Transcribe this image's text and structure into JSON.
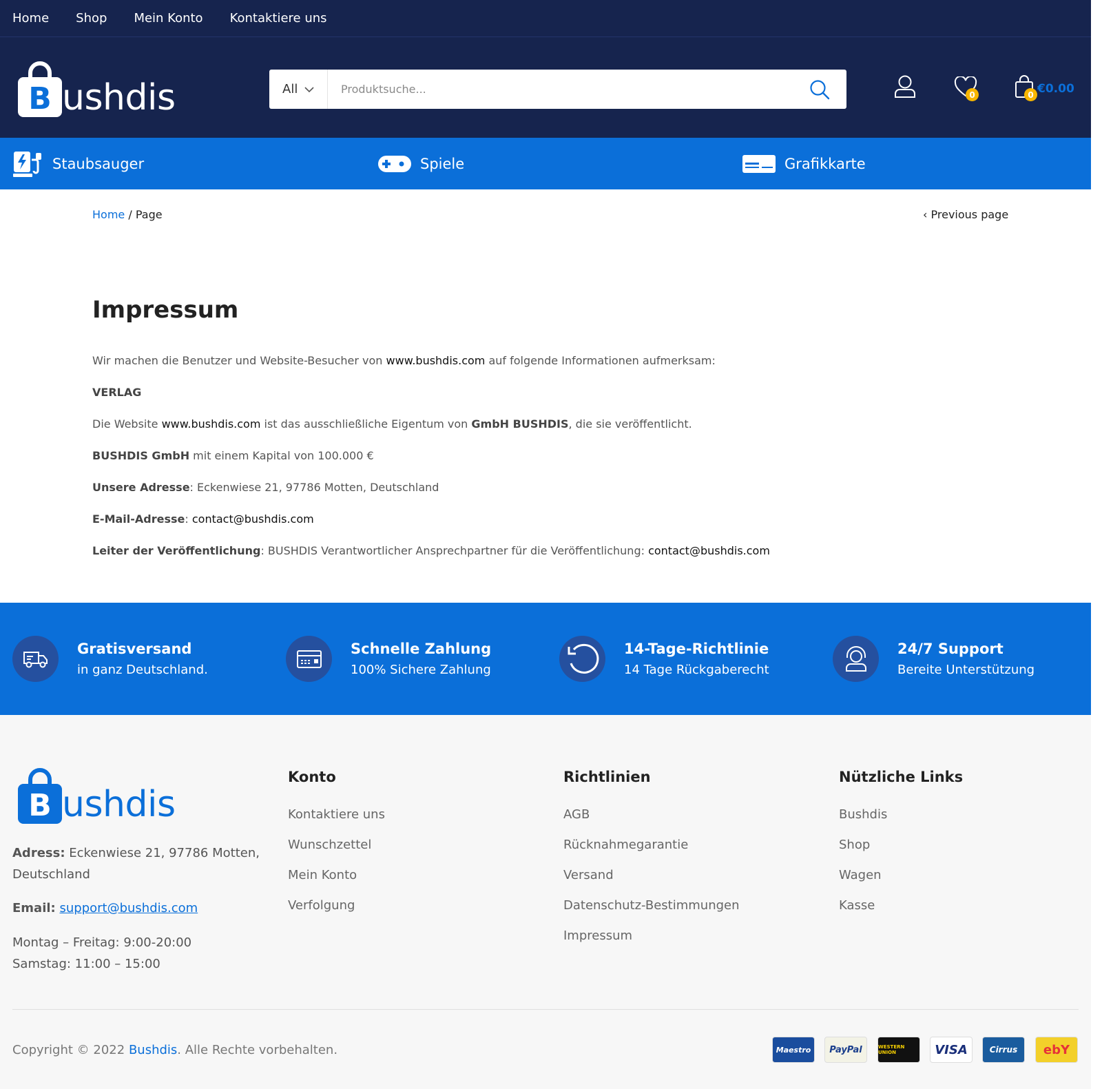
{
  "topnav": [
    {
      "label": "Home"
    },
    {
      "label": "Shop"
    },
    {
      "label": "Mein Konto"
    },
    {
      "label": "Kontaktiere uns"
    }
  ],
  "header": {
    "logo_word": "ushdis",
    "logo_letter": "B",
    "search_category": "All",
    "search_placeholder": "Produktsuche...",
    "wishlist_count": "0",
    "cart_count": "0",
    "cart_total": "€0.00"
  },
  "categories": [
    {
      "label": "Staubsauger",
      "icon": "vacuum-icon"
    },
    {
      "label": "Spiele",
      "icon": "gamepad-icon"
    },
    {
      "label": "Grafikkarte",
      "icon": "graphics-card-icon"
    }
  ],
  "breadcrumb": {
    "home": "Home",
    "sep": "/",
    "current": "Page"
  },
  "previous_page": "Previous page",
  "content": {
    "title": "Impressum",
    "intro_a": "Wir machen die Benutzer und Website-Besucher von ",
    "intro_link": "www.bushdis.com",
    "intro_b": " auf folgende Informationen aufmerksam:",
    "verlag": "VERLAG",
    "site_a": "Die Website ",
    "site_link": "www.bushdis.com",
    "site_b": " ist das ausschließliche Eigentum von ",
    "site_owner": "GmbH BUSHDIS",
    "site_c": ", die sie veröffentlicht.",
    "capital_label": "BUSHDIS GmbH",
    "capital_text": " mit einem Kapital von 100.000 €",
    "address_label": "Unsere Adresse",
    "address_text": ": Eckenwiese 21, 97786 Motten, Deutschland",
    "email_label": "E-Mail-Adresse",
    "email_sep": ": ",
    "email_value": "contact@bushdis.com",
    "leader_label": "Leiter der Veröffentlichung",
    "leader_text": ": BUSHDIS Verantwortlicher Ansprechpartner für die Veröffentlichung: ",
    "leader_email": "contact@bushdis.com"
  },
  "features": [
    {
      "title": "Gratisversand",
      "sub": "in ganz Deutschland.",
      "icon": "truck-icon"
    },
    {
      "title": "Schnelle Zahlung",
      "sub": "100% Sichere Zahlung",
      "icon": "credit-card-icon"
    },
    {
      "title": "14-Tage-Richtlinie",
      "sub": "14 Tage Rückgaberecht",
      "icon": "return-icon"
    },
    {
      "title": "24/7 Support",
      "sub": "Bereite Unterstützung",
      "icon": "headset-icon"
    }
  ],
  "footer": {
    "address_label": "Adress:",
    "address_value": " Eckenwiese 21, 97786 Motten, Deutschland",
    "email_label": "Email:",
    "email_value": "support@bushdis.com",
    "hours_1": "Montag – Freitag: 9:00-20:00",
    "hours_2": "Samstag: 11:00 – 15:00",
    "columns": [
      {
        "title": "Konto",
        "links": [
          "Kontaktiere uns",
          "Wunschzettel",
          "Mein Konto",
          "Verfolgung"
        ]
      },
      {
        "title": "Richtlinien",
        "links": [
          "AGB",
          "Rücknahmegarantie",
          "Versand",
          "Datenschutz-Bestimmungen",
          "Impressum"
        ]
      },
      {
        "title": "Nützliche Links",
        "links": [
          "Bushdis",
          "Shop",
          "Wagen",
          "Kasse"
        ]
      }
    ],
    "copyright_a": "Copyright © 2022 ",
    "copyright_link": "Bushdis",
    "copyright_b": ". Alle Rechte vorbehalten.",
    "payments": [
      "Maestro",
      "PayPal",
      "WESTERN UNION",
      "VISA",
      "Cirrus",
      "ebY"
    ]
  },
  "colors": {
    "navy": "#16244e",
    "blue": "#0b6fd9",
    "badge": "#f7b600"
  }
}
